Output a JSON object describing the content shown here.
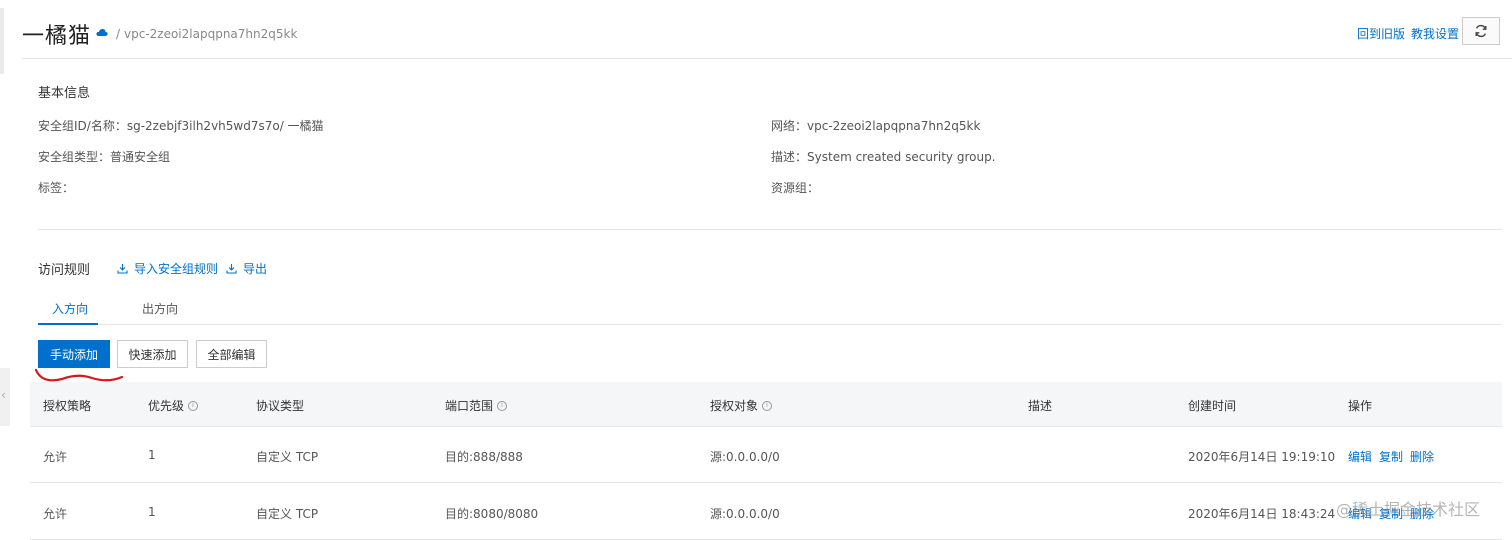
{
  "header": {
    "title": "一橘猫",
    "breadcrumb_sep": "/",
    "vpc_id": "vpc-2zeoi2lapqpna7hn2q5kk",
    "links": {
      "old_version": "回到旧版",
      "tutorial_settings": "教我设置"
    },
    "refresh_icon": "refresh-icon"
  },
  "basic_info": {
    "title": "基本信息",
    "left": [
      {
        "label": "安全组ID/名称：",
        "value": "sg-2zebjf3ilh2vh5wd7s7o/ 一橘猫"
      },
      {
        "label": "安全组类型：",
        "value": "普通安全组"
      },
      {
        "label": "标签：",
        "value": ""
      }
    ],
    "right": [
      {
        "label": "网络：",
        "value": "vpc-2zeoi2lapqpna7hn2q5kk"
      },
      {
        "label": "描述：",
        "value": "System created security group."
      },
      {
        "label": "资源组：",
        "value": ""
      }
    ]
  },
  "rules": {
    "title": "访问规则",
    "import_label": "导入安全组规则",
    "export_label": "导出",
    "tabs": [
      {
        "label": "入方向",
        "active": true
      },
      {
        "label": "出方向",
        "active": false
      }
    ],
    "buttons": {
      "manual_add": "手动添加",
      "quick_add": "快速添加",
      "edit_all": "全部编辑"
    }
  },
  "table": {
    "columns": [
      "授权策略",
      "优先级",
      "协议类型",
      "端口范围",
      "授权对象",
      "描述",
      "创建时间",
      "操作"
    ],
    "rows": [
      {
        "policy": "允许",
        "priority": "1",
        "protocol": "自定义 TCP",
        "port": "目的:888/888",
        "target": "源:0.0.0.0/0",
        "desc": "",
        "created": "2020年6月14日 19:19:10"
      },
      {
        "policy": "允许",
        "priority": "1",
        "protocol": "自定义 TCP",
        "port": "目的:8080/8080",
        "target": "源:0.0.0.0/0",
        "desc": "",
        "created": "2020年6月14日 18:43:24"
      }
    ],
    "actions": {
      "edit": "编辑",
      "copy": "复制",
      "delete": "删除"
    }
  },
  "colors": {
    "accent": "#0070cc",
    "annotation": "#d9161b"
  },
  "watermark": "@稀土掘金技术社区"
}
